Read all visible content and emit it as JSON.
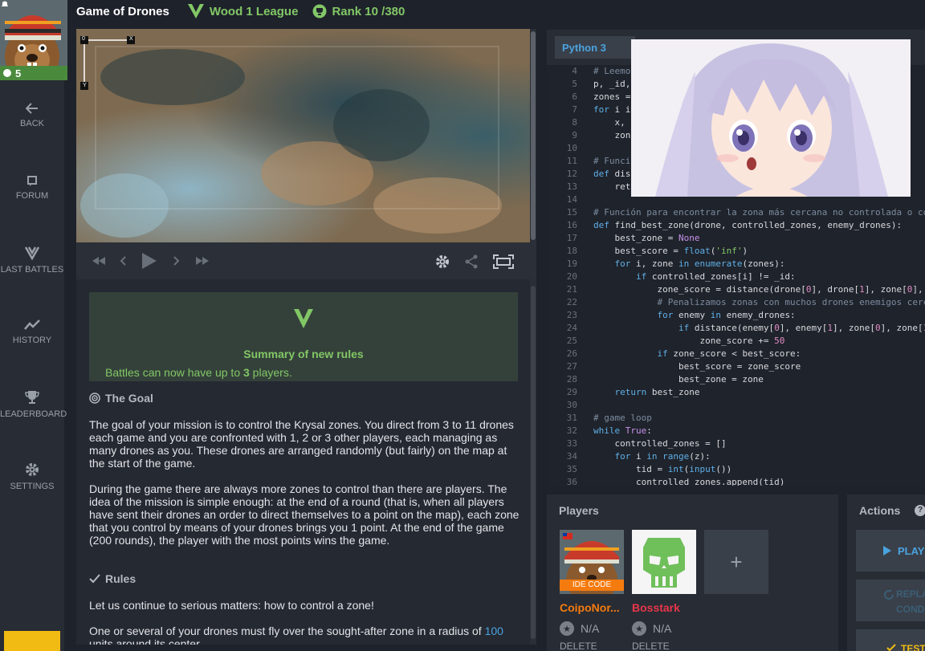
{
  "user": {
    "level": "5"
  },
  "sidebar": {
    "items": [
      {
        "label": "BACK",
        "icon": "back-arrow-icon"
      },
      {
        "label": "FORUM",
        "icon": "forum-icon"
      },
      {
        "label": "LAST BATTLES",
        "icon": "battles-icon"
      },
      {
        "label": "HISTORY",
        "icon": "history-icon"
      },
      {
        "label": "LEADERBOARD",
        "icon": "trophy-icon"
      },
      {
        "label": "SETTINGS",
        "icon": "gear-icon"
      }
    ]
  },
  "header": {
    "title": "Game of Drones",
    "league": "Wood 1 League",
    "rank": "Rank 10 /380"
  },
  "viewer": {
    "origin_label": "0",
    "x_label": "X",
    "y_label": "Y"
  },
  "statement": {
    "rules_title": "Summary of new rules",
    "rules_text_pre": "Battles can now have up to ",
    "rules_text_num": "3",
    "rules_text_post": " players.",
    "goal_title": "The Goal",
    "goal_p1": "The goal of your mission is to control the Krysal zones. You direct from 3 to 11 drones each game and you are confronted with 1, 2 or 3 other players, each managing as many drones as you. These drones are arranged randomly (but fairly) on the map at the start of the game.",
    "goal_p2": "During the game there are always more zones to control than there are players. The idea of the mission is simple enough: at the end of a round (that is, when all players have sent their drones an order to direct themselves to a point on the map), each zone that you control by means of your drones brings you 1 point. At the end of the game (200 rounds), the player with the most points wins the game.",
    "rules_head": "Rules",
    "rules_p1": "Let us continue to serious matters: how to control a zone!",
    "rules_p2_pre": "One or several of your drones must fly over the sought-after zone in a radius of ",
    "rules_p2_num": "100",
    "rules_p2_post": " units around its center."
  },
  "editor": {
    "language": "Python 3",
    "lines": [
      {
        "n": "4",
        "t": "# Leemo"
      },
      {
        "n": "5",
        "t": "p, _id,"
      },
      {
        "n": "6",
        "t": "zones ="
      },
      {
        "n": "7",
        "t": "for i i"
      },
      {
        "n": "8",
        "t": "    x,"
      },
      {
        "n": "9",
        "t": "    zon"
      },
      {
        "n": "10",
        "t": ""
      },
      {
        "n": "11",
        "t": "# Funci"
      },
      {
        "n": "12",
        "t": "def dis"
      },
      {
        "n": "13",
        "t": "    ret"
      },
      {
        "n": "14",
        "t": ""
      },
      {
        "n": "15",
        "t": "# Función para encontrar la zona más cercana no controlada o co"
      },
      {
        "n": "16",
        "t": "def find_best_zone(drone, controlled_zones, enemy_drones):"
      },
      {
        "n": "17",
        "t": "    best_zone = None"
      },
      {
        "n": "18",
        "t": "    best_score = float('inf')"
      },
      {
        "n": "19",
        "t": "    for i, zone in enumerate(zones):"
      },
      {
        "n": "20",
        "t": "        if controlled_zones[i] != _id:"
      },
      {
        "n": "21",
        "t": "            zone_score = distance(drone[0], drone[1], zone[0],"
      },
      {
        "n": "22",
        "t": "            # Penalizamos zonas con muchos drones enemigos cerc"
      },
      {
        "n": "23",
        "t": "            for enemy in enemy_drones:"
      },
      {
        "n": "24",
        "t": "                if distance(enemy[0], enemy[1], zone[0], zone[1"
      },
      {
        "n": "25",
        "t": "                    zone_score += 50"
      },
      {
        "n": "26",
        "t": "            if zone_score < best_score:"
      },
      {
        "n": "27",
        "t": "                best_score = zone_score"
      },
      {
        "n": "28",
        "t": "                best_zone = zone"
      },
      {
        "n": "29",
        "t": "    return best_zone"
      },
      {
        "n": "30",
        "t": ""
      },
      {
        "n": "31",
        "t": "# game loop"
      },
      {
        "n": "32",
        "t": "while True:"
      },
      {
        "n": "33",
        "t": "    controlled_zones = []"
      },
      {
        "n": "34",
        "t": "    for i in range(z):"
      },
      {
        "n": "35",
        "t": "        tid = int(input())"
      },
      {
        "n": "36",
        "t": "        controlled_zones.append(tid)"
      }
    ]
  },
  "players": {
    "title": "Players",
    "list": [
      {
        "name": "CoipoNor...",
        "rank": "N/A",
        "delete": "DELETE",
        "badge": "IDE CODE",
        "color": "#f57b0f"
      },
      {
        "name": "Bosstark",
        "rank": "N/A",
        "delete": "DELETE",
        "color": "#e8364a"
      }
    ],
    "add_label": "+"
  },
  "actions": {
    "title": "Actions",
    "help": "?",
    "play": "PLAY",
    "replay": "REPLA",
    "replay2": "COND",
    "test": "TEST"
  }
}
